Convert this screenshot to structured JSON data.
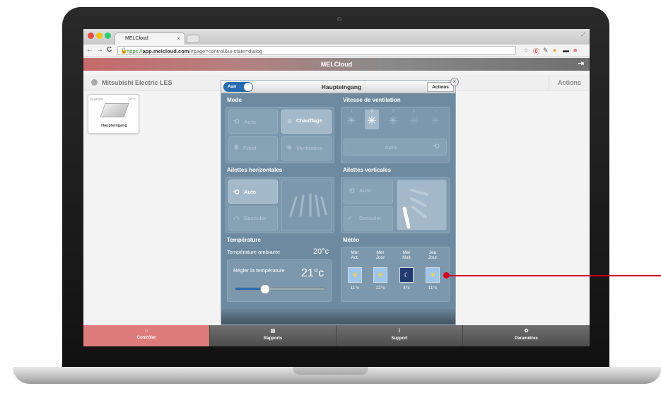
{
  "browser": {
    "tab_title": "MELCloud",
    "tab_close": "×",
    "url_scheme": "https://",
    "url_host": "app.melcloud.com",
    "url_path": "/#page=control&ui-state=dialog",
    "back": "←",
    "forward": "→",
    "reload": "C"
  },
  "app": {
    "title": "MELCloud",
    "building": "Mitsubishi Electric LES",
    "actions": "Actions"
  },
  "unit_card": {
    "mode": "Marche",
    "temp": "20°c",
    "name": "Haupteingang"
  },
  "dialog": {
    "power_label": "Aan",
    "title": "Haupteingang",
    "actions": "Actions",
    "mode": {
      "heading": "Mode",
      "auto": "Auto",
      "heat": "Chauffage",
      "cool": "Froid",
      "fan": "Ventilation"
    },
    "fan_speed": {
      "heading": "Vitesse de ventilation",
      "levels": [
        "1",
        "2",
        "3",
        "4",
        "5"
      ],
      "auto": "Auto"
    },
    "vanes_h": {
      "heading": "Ailettes horizontales",
      "auto": "Auto",
      "swing": "Basculer"
    },
    "vanes_v": {
      "heading": "Ailettes verticales",
      "auto": "Auto",
      "swing": "Basculer"
    },
    "temperature": {
      "heading": "Température",
      "ambient_label": "Température ambiante",
      "ambient_value": "20°c",
      "set_label": "Régler la température",
      "set_value": "21°c",
      "slider_fraction": 0.33
    },
    "weather": {
      "heading": "Météo",
      "days": [
        {
          "day": "Mer",
          "period": "Act.",
          "temp": "11°c",
          "icon": "sun-icon"
        },
        {
          "day": "Mer",
          "period": "Jour",
          "temp": "12°c",
          "icon": "sun-icon"
        },
        {
          "day": "Mer",
          "period": "Nuit",
          "temp": "4°c",
          "icon": "moon-icon"
        },
        {
          "day": "Jeu",
          "period": "Jour",
          "temp": "11°c",
          "icon": "sun-icon"
        }
      ]
    }
  },
  "bottom_nav": {
    "control": "Contrôler",
    "reports": "Rapports",
    "support": "Support",
    "settings": "Paramètres"
  },
  "colors": {
    "accent_red": "#de7b7b",
    "dialog_blue": "#6e8aa0",
    "toggle_blue": "#2b6cb0",
    "annotation_red": "#d0021b"
  }
}
